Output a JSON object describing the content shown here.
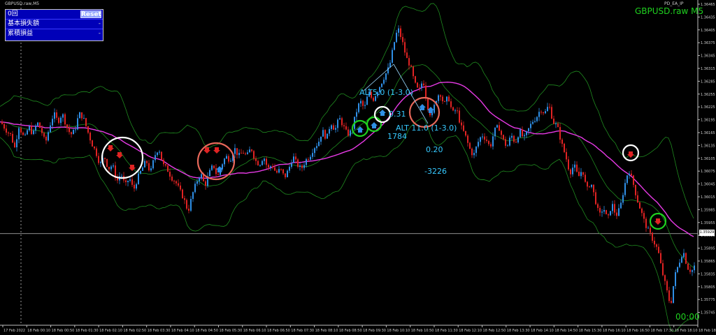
{
  "window": {
    "title": "GBPUSD.raw,M5",
    "ea_name": "PD_EA_IP"
  },
  "panel": {
    "header": "0回",
    "reset_label": "Reset",
    "row1_label": "基本損失額",
    "row1_value": "-",
    "row2_label": "累積損益",
    "row2_value": "-"
  },
  "symbol_label": "GBPUSD.raw M5",
  "timer": "00:00",
  "annotations": {
    "alt1": "ALT5.0 (1-3.0)",
    "v031": "0.31",
    "alt2": "ALT 11.0 (1-3.0)",
    "v1784": "1784",
    "v020": "0.20",
    "vneg": "-3226"
  },
  "current_price": "1.35929",
  "colors": {
    "bull": "#2f8fe6",
    "bear": "#e02323",
    "bands": "#1f8a1f",
    "ma": "#e83ae6",
    "signal_green": "#1fd11f",
    "signal_white": "#ffffff",
    "signal_red": "#e8685a",
    "text_cyan": "#36c9ff"
  },
  "chart_data": {
    "type": "candlestick",
    "symbol": "GBPUSD.raw",
    "timeframe": "M5",
    "y_axis": {
      "ticks": [
        "1.36465",
        "1.36435",
        "1.36405",
        "1.36375",
        "1.36345",
        "1.36315",
        "1.36285",
        "1.36255",
        "1.36225",
        "1.36195",
        "1.36165",
        "1.36135",
        "1.36105",
        "1.36075",
        "1.36045",
        "1.36015",
        "1.35985",
        "1.35955",
        "1.35925",
        "1.35895",
        "1.35865",
        "1.35835",
        "1.35805",
        "1.35775",
        "1.35745"
      ],
      "ylim": [
        1.35715,
        1.36465
      ]
    },
    "x_axis": {
      "ticks": [
        "17 Feb 2022",
        "18 Feb 00:10",
        "18 Feb 00:50",
        "18 Feb 01:30",
        "18 Feb 02:10",
        "18 Feb 02:50",
        "18 Feb 03:30",
        "18 Feb 04:10",
        "18 Feb 04:50",
        "18 Feb 05:30",
        "18 Feb 06:10",
        "18 Feb 06:50",
        "18 Feb 07:30",
        "18 Feb 08:10",
        "18 Feb 08:50",
        "18 Feb 09:30",
        "18 Feb 10:10",
        "18 Feb 10:50",
        "18 Feb 11:30",
        "18 Feb 12:10",
        "18 Feb 12:50",
        "18 Feb 13:30",
        "18 Feb 14:10",
        "18 Feb 14:50",
        "18 Feb 15:30",
        "18 Feb 16:10",
        "18 Feb 16:50",
        "18 Feb 17:30",
        "18 Feb 18:10",
        "18 Feb 18:50"
      ]
    },
    "close_path": [
      [
        0,
        1.3619
      ],
      [
        8,
        1.3617
      ],
      [
        14,
        1.3616
      ],
      [
        20,
        1.3613
      ],
      [
        26,
        1.3618
      ],
      [
        34,
        1.3615
      ],
      [
        40,
        1.3618
      ],
      [
        46,
        1.3616
      ],
      [
        52,
        1.3619
      ],
      [
        58,
        1.3617
      ],
      [
        64,
        1.3614
      ],
      [
        70,
        1.3618
      ],
      [
        76,
        1.3621
      ],
      [
        82,
        1.3619
      ],
      [
        88,
        1.3621
      ],
      [
        94,
        1.3618
      ],
      [
        100,
        1.3616
      ],
      [
        106,
        1.3617
      ],
      [
        112,
        1.3621
      ],
      [
        118,
        1.362
      ],
      [
        124,
        1.3617
      ],
      [
        130,
        1.3614
      ],
      [
        136,
        1.3612
      ],
      [
        142,
        1.3609
      ],
      [
        148,
        1.3611
      ],
      [
        154,
        1.3608
      ],
      [
        160,
        1.3609
      ],
      [
        166,
        1.3605
      ],
      [
        172,
        1.3607
      ],
      [
        178,
        1.3604
      ],
      [
        184,
        1.3606
      ],
      [
        190,
        1.3603
      ],
      [
        196,
        1.3606
      ],
      [
        202,
        1.3608
      ],
      [
        208,
        1.361
      ],
      [
        214,
        1.3607
      ],
      [
        220,
        1.3611
      ],
      [
        226,
        1.3613
      ],
      [
        232,
        1.3609
      ],
      [
        238,
        1.3608
      ],
      [
        244,
        1.3606
      ],
      [
        250,
        1.3605
      ],
      [
        256,
        1.3603
      ],
      [
        262,
        1.3601
      ],
      [
        268,
        1.3598
      ],
      [
        274,
        1.3602
      ],
      [
        280,
        1.3605
      ],
      [
        286,
        1.3607
      ],
      [
        292,
        1.3604
      ],
      [
        298,
        1.3607
      ],
      [
        304,
        1.3609
      ],
      [
        310,
        1.3606
      ],
      [
        316,
        1.3609
      ],
      [
        322,
        1.3611
      ],
      [
        328,
        1.361
      ],
      [
        334,
        1.3613
      ],
      [
        340,
        1.3611
      ],
      [
        346,
        1.3612
      ],
      [
        352,
        1.3611
      ],
      [
        358,
        1.3613
      ],
      [
        364,
        1.361
      ],
      [
        370,
        1.3609
      ],
      [
        376,
        1.3611
      ],
      [
        382,
        1.3608
      ],
      [
        388,
        1.3609
      ],
      [
        394,
        1.3607
      ],
      [
        400,
        1.3608
      ],
      [
        406,
        1.3606
      ],
      [
        412,
        1.3608
      ],
      [
        418,
        1.3611
      ],
      [
        424,
        1.3609
      ],
      [
        430,
        1.3608
      ],
      [
        436,
        1.361
      ],
      [
        442,
        1.3611
      ],
      [
        448,
        1.3613
      ],
      [
        454,
        1.3614
      ],
      [
        460,
        1.3617
      ],
      [
        466,
        1.3615
      ],
      [
        472,
        1.3619
      ],
      [
        478,
        1.3617
      ],
      [
        484,
        1.362
      ],
      [
        490,
        1.3618
      ],
      [
        496,
        1.3616
      ],
      [
        502,
        1.3617
      ],
      [
        508,
        1.3621
      ],
      [
        514,
        1.3624
      ],
      [
        520,
        1.3622
      ],
      [
        526,
        1.3626
      ],
      [
        532,
        1.3624
      ],
      [
        538,
        1.3626
      ],
      [
        544,
        1.3628
      ],
      [
        550,
        1.363
      ],
      [
        556,
        1.3632
      ],
      [
        562,
        1.3637
      ],
      [
        568,
        1.3641
      ],
      [
        574,
        1.3638
      ],
      [
        580,
        1.3634
      ],
      [
        586,
        1.3632
      ],
      [
        592,
        1.3628
      ],
      [
        598,
        1.3626
      ],
      [
        604,
        1.3629
      ],
      [
        610,
        1.3623
      ],
      [
        616,
        1.362
      ],
      [
        622,
        1.3624
      ],
      [
        628,
        1.3626
      ],
      [
        634,
        1.3623
      ],
      [
        640,
        1.3625
      ],
      [
        646,
        1.3621
      ],
      [
        652,
        1.3622
      ],
      [
        658,
        1.3618
      ],
      [
        664,
        1.3616
      ],
      [
        670,
        1.3613
      ],
      [
        676,
        1.3611
      ],
      [
        682,
        1.3614
      ],
      [
        688,
        1.3616
      ],
      [
        694,
        1.3615
      ],
      [
        700,
        1.3613
      ],
      [
        706,
        1.3617
      ],
      [
        712,
        1.3618
      ],
      [
        718,
        1.3615
      ],
      [
        724,
        1.3613
      ],
      [
        730,
        1.3616
      ],
      [
        736,
        1.3614
      ],
      [
        742,
        1.3617
      ],
      [
        748,
        1.3615
      ],
      [
        754,
        1.3617
      ],
      [
        760,
        1.3619
      ],
      [
        766,
        1.362
      ],
      [
        772,
        1.3622
      ],
      [
        778,
        1.3621
      ],
      [
        784,
        1.3623
      ],
      [
        790,
        1.3619
      ],
      [
        796,
        1.3618
      ],
      [
        802,
        1.3614
      ],
      [
        808,
        1.3611
      ],
      [
        814,
        1.3607
      ],
      [
        820,
        1.3609
      ],
      [
        826,
        1.3606
      ],
      [
        832,
        1.3608
      ],
      [
        838,
        1.3603
      ],
      [
        844,
        1.3605
      ],
      [
        850,
        1.3601
      ],
      [
        856,
        1.3597
      ],
      [
        862,
        1.3599
      ],
      [
        868,
        1.3596
      ],
      [
        874,
        1.36
      ],
      [
        880,
        1.3597
      ],
      [
        886,
        1.3599
      ],
      [
        892,
        1.3604
      ],
      [
        898,
        1.3608
      ],
      [
        904,
        1.3605
      ],
      [
        910,
        1.3601
      ],
      [
        916,
        1.3598
      ],
      [
        922,
        1.3595
      ],
      [
        928,
        1.3593
      ],
      [
        934,
        1.3591
      ],
      [
        940,
        1.3589
      ],
      [
        946,
        1.3584
      ],
      [
        952,
        1.358
      ],
      [
        958,
        1.3576
      ],
      [
        964,
        1.3583
      ],
      [
        970,
        1.3586
      ],
      [
        976,
        1.3589
      ],
      [
        982,
        1.3585
      ],
      [
        988,
        1.3584
      ],
      [
        994,
        1.3586
      ]
    ],
    "indicators": [
      "Bollinger Bands (green)",
      "Moving Average (magenta)"
    ]
  }
}
